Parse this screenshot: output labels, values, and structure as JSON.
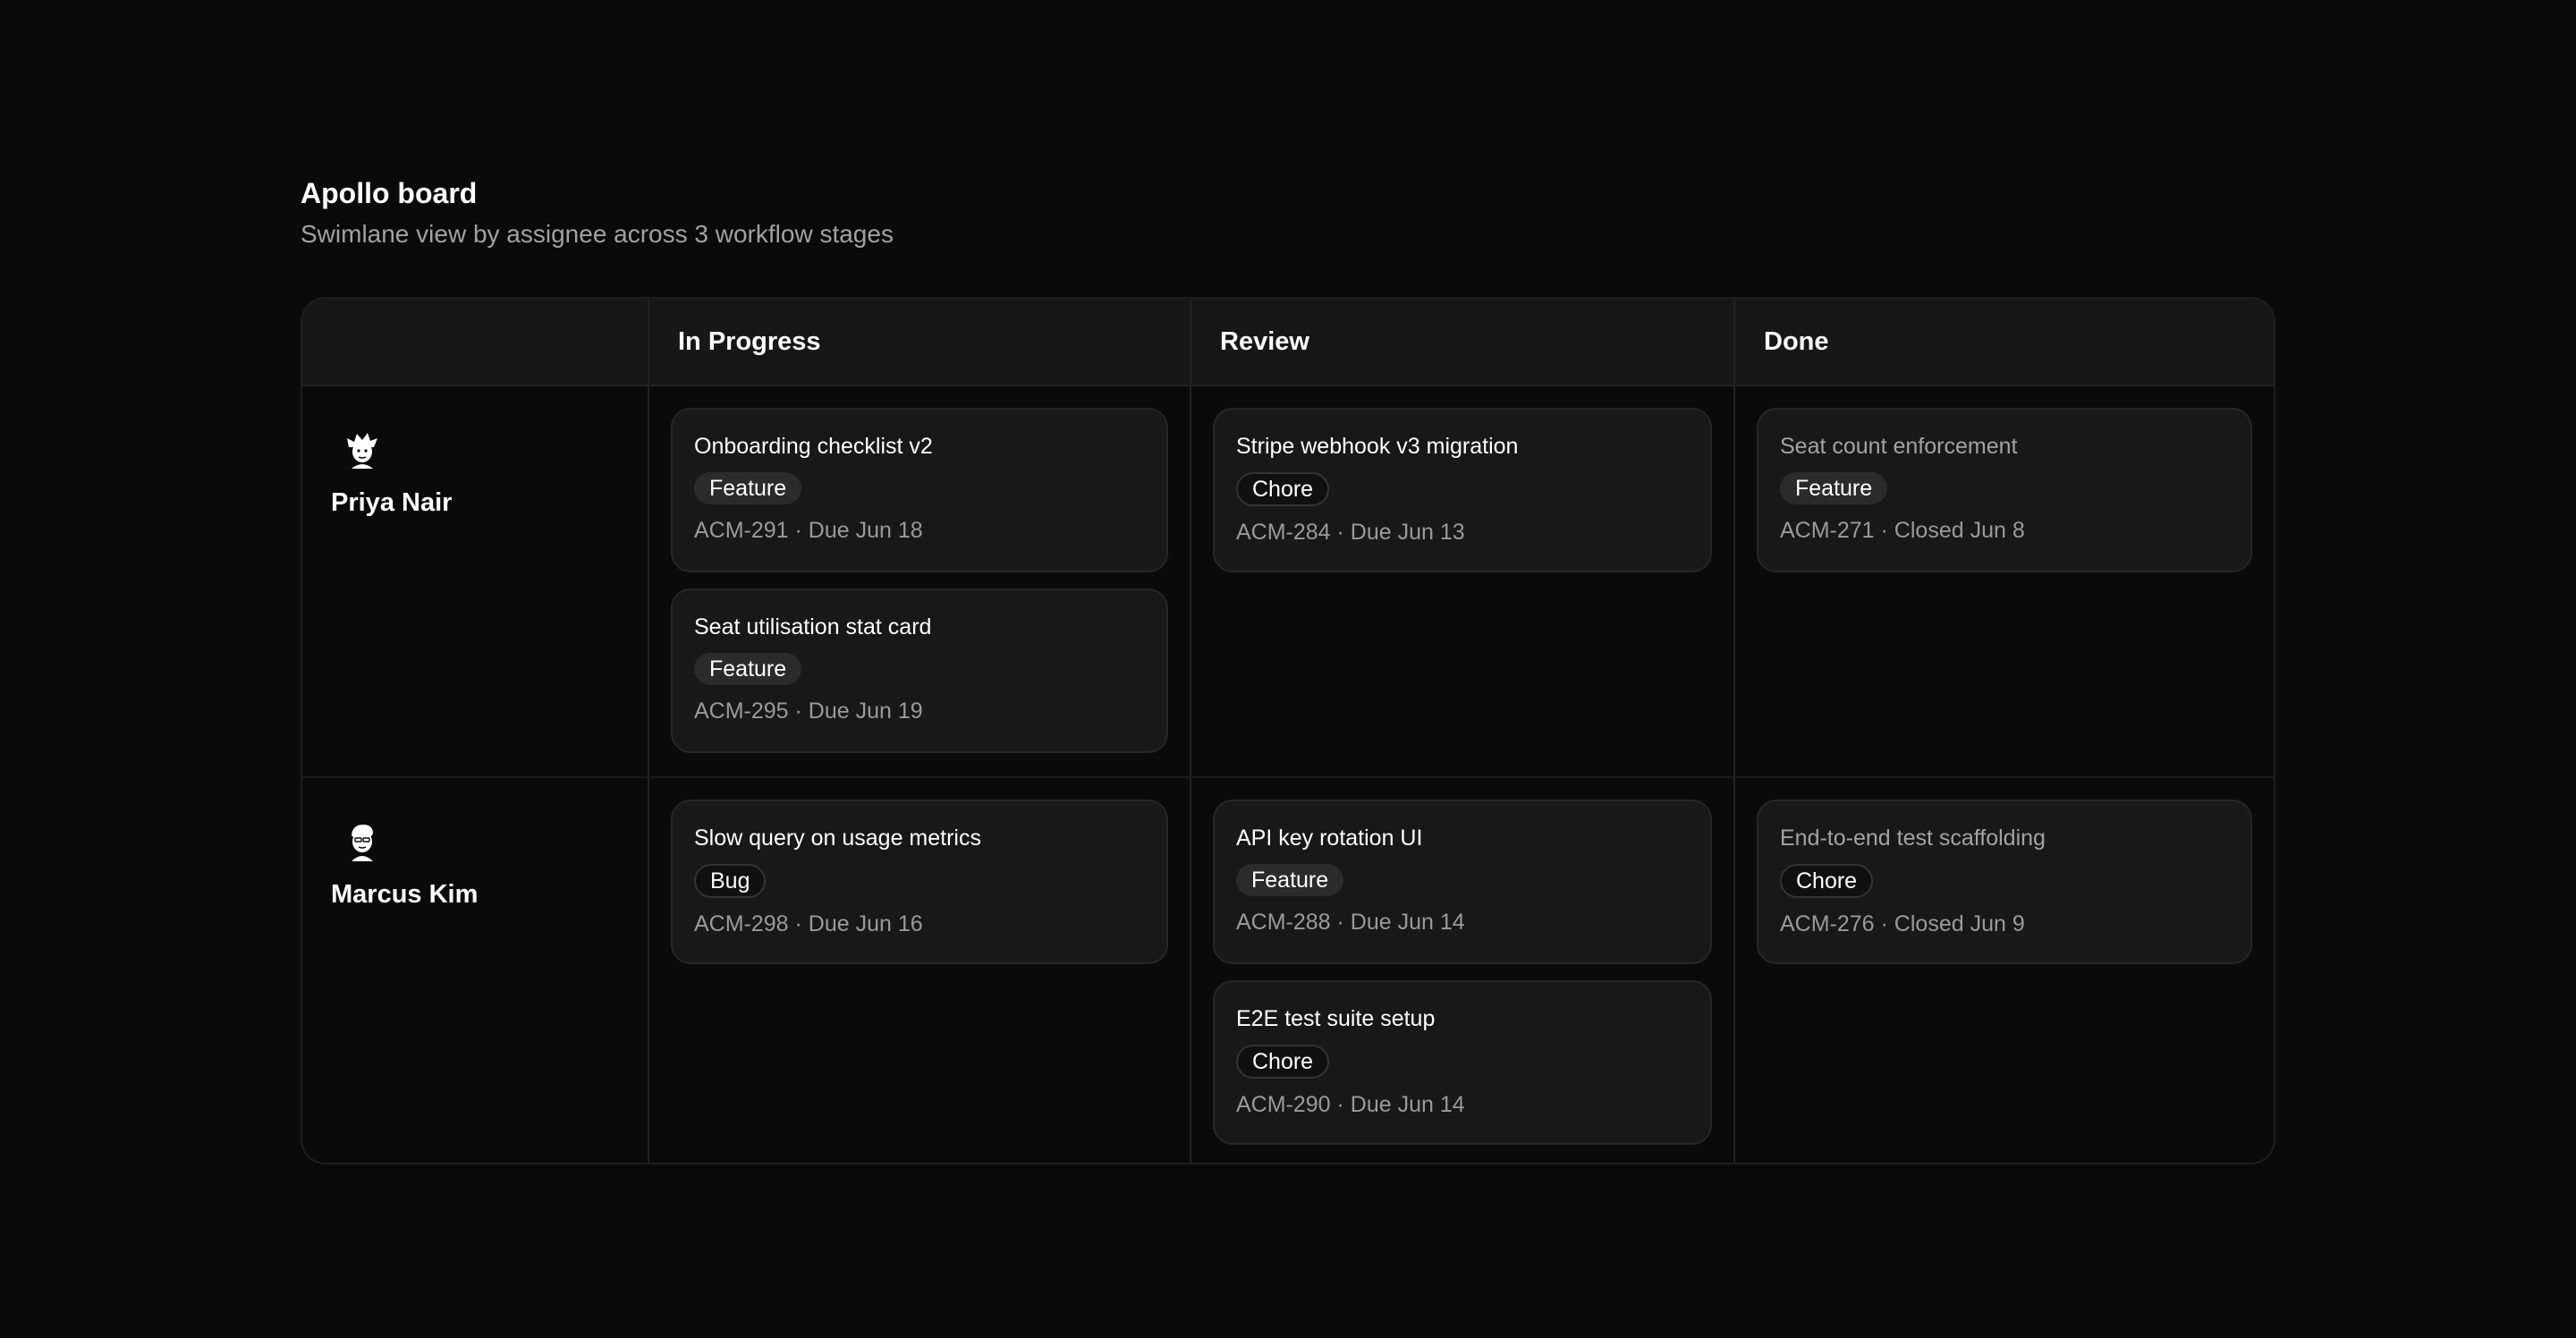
{
  "board": {
    "title": "Apollo board",
    "subtitle": "Swimlane view by assignee across 3 workflow stages"
  },
  "columns": [
    "In Progress",
    "Review",
    "Done"
  ],
  "lanes": [
    {
      "assignee": "Priya Nair",
      "avatar_icon": "avatar-illustration-icon",
      "in_progress": [
        {
          "title": "Onboarding checklist v2",
          "tag": "Feature",
          "meta": "ACM-291 · Due Jun 18"
        },
        {
          "title": "Seat utilisation stat card",
          "tag": "Feature",
          "meta": "ACM-295 · Due Jun 19"
        }
      ],
      "review": [
        {
          "title": "Stripe webhook v3 migration",
          "tag": "Chore",
          "meta": "ACM-284 · Due Jun 13"
        }
      ],
      "done": [
        {
          "title": "Seat count enforcement",
          "tag": "Feature",
          "meta": "ACM-271 · Closed Jun 8"
        }
      ]
    },
    {
      "assignee": "Marcus Kim",
      "avatar_icon": "avatar-illustration-icon",
      "in_progress": [
        {
          "title": "Slow query on usage metrics",
          "tag": "Bug",
          "meta": "ACM-298 · Due Jun 16"
        }
      ],
      "review": [
        {
          "title": "API key rotation UI",
          "tag": "Feature",
          "meta": "ACM-288 · Due Jun 14"
        },
        {
          "title": "E2E test suite setup",
          "tag": "Chore",
          "meta": "ACM-290 · Due Jun 14"
        }
      ],
      "done": [
        {
          "title": "End-to-end test scaffolding",
          "tag": "Chore",
          "meta": "ACM-276 · Closed Jun 9"
        }
      ]
    }
  ],
  "colors": {
    "background": "#0a0a0a",
    "card": "#181818",
    "header": "#171717",
    "muted_text": "#9a9a9a"
  }
}
